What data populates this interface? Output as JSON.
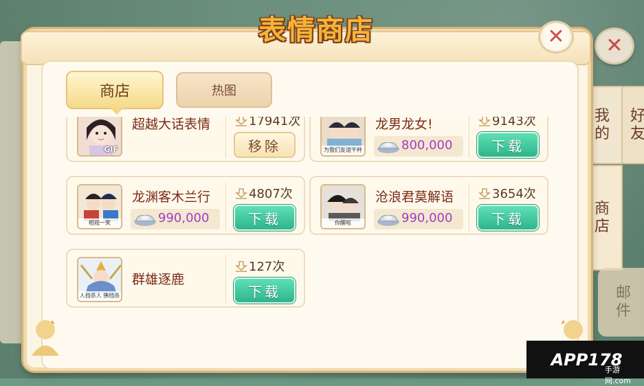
{
  "dialog": {
    "title": "表情商店",
    "close_label": "✕"
  },
  "tabs": [
    {
      "label": "商店",
      "active": true
    },
    {
      "label": "热图",
      "active": false
    }
  ],
  "side_tabs": {
    "mine": "我的",
    "friend": "好友",
    "shop": "商店",
    "mail": "邮件"
  },
  "items": [
    {
      "name": "超越大话表情",
      "count": "17941次",
      "price": null,
      "button": "移除",
      "thumb_badge": "GIF",
      "thumb_caption": ""
    },
    {
      "name": "龙男龙女!",
      "count": "9143次",
      "price": "800,000",
      "button": "下载",
      "thumb_badge": "",
      "thumb_caption": "为我们友谊干杯"
    },
    {
      "name": "龙渊客木兰行",
      "count": "4807次",
      "price": "990,000",
      "button": "下载",
      "thumb_badge": "",
      "thumb_caption": "相视一笑"
    },
    {
      "name": "沧浪君莫解语",
      "count": "3654次",
      "price": "990,000",
      "button": "下载",
      "thumb_badge": "",
      "thumb_caption": "你醒啦"
    },
    {
      "name": "群雄逐鹿",
      "count": "127次",
      "price": null,
      "button": "下载",
      "thumb_badge": "",
      "thumb_caption": "人挡杀人 佛挡杀佛"
    }
  ],
  "watermark": {
    "text": "APP178",
    "sub": "手游网.com"
  },
  "colors": {
    "download_button": "#2fb48a",
    "price": "#a23cc7",
    "item_name": "#7b2a16",
    "title": "#f4b43a"
  }
}
